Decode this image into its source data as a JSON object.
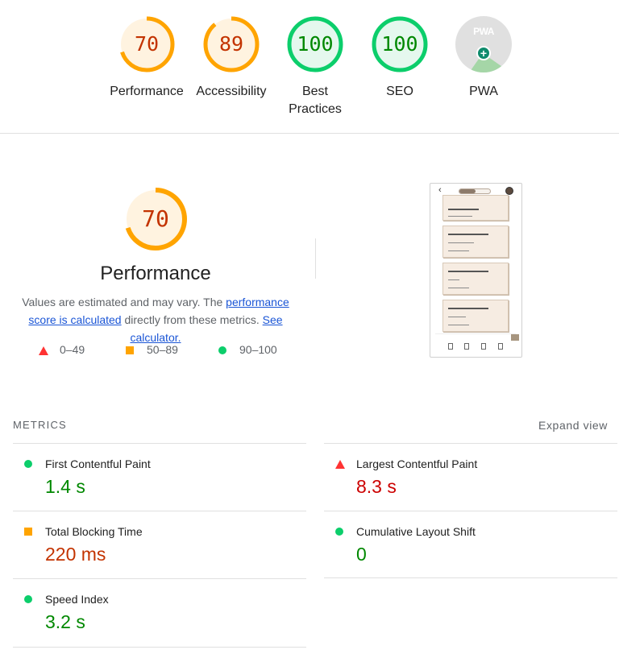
{
  "categories": [
    {
      "score": "70",
      "label": "Performance",
      "status": "average",
      "fraction": 0.7
    },
    {
      "score": "89",
      "label": "Accessibility",
      "status": "average",
      "fraction": 0.89
    },
    {
      "score": "100",
      "label": "Best Practices",
      "label_line1": "Best",
      "label_line2": "Practices",
      "status": "pass",
      "fraction": 1.0
    },
    {
      "score": "100",
      "label": "SEO",
      "status": "pass",
      "fraction": 1.0
    },
    {
      "score": "",
      "label": "PWA",
      "badge_text": "PWA",
      "status": "badge"
    }
  ],
  "performance": {
    "score": "70",
    "fraction": 0.7,
    "title": "Performance",
    "desc_prefix": "Values are estimated and may vary. The ",
    "desc_link1": "performance score is calculated",
    "desc_middle": " directly from these metrics. ",
    "desc_link2": "See calculator.",
    "legend": [
      {
        "range": "0–49",
        "icon": "red-triangle-icon"
      },
      {
        "range": "50–89",
        "icon": "orange-square-icon"
      },
      {
        "range": "90–100",
        "icon": "green-circle-icon"
      }
    ]
  },
  "metrics": {
    "heading": "METRICS",
    "expand_label": "Expand view",
    "items": [
      {
        "name": "First Contentful Paint",
        "value": "1.4 s",
        "status": "pass"
      },
      {
        "name": "Largest Contentful Paint",
        "value": "8.3 s",
        "status": "fail"
      },
      {
        "name": "Total Blocking Time",
        "value": "220 ms",
        "status": "average"
      },
      {
        "name": "Cumulative Layout Shift",
        "value": "0",
        "status": "pass"
      },
      {
        "name": "Speed Index",
        "value": "3.2 s",
        "status": "pass"
      }
    ]
  },
  "colors": {
    "average": "#ffa400",
    "average_bg": "#fff3e0",
    "pass": "#0cce6b",
    "pass_bg": "#e5f8ee",
    "fail": "#ff3333",
    "average_text": "#c33300",
    "pass_text": "#008800",
    "fail_text": "#cc0000"
  }
}
